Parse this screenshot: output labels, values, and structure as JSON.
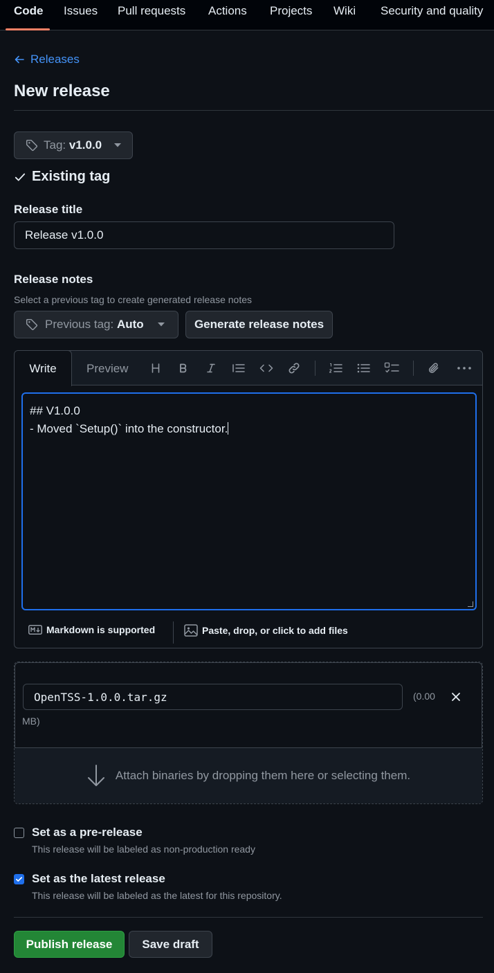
{
  "nav": {
    "tabs": [
      {
        "label": "Code",
        "active": true
      },
      {
        "label": "Issues"
      },
      {
        "label": "Pull requests"
      },
      {
        "label": "Actions"
      },
      {
        "label": "Projects"
      },
      {
        "label": "Wiki"
      },
      {
        "label": "Security and quality"
      }
    ]
  },
  "breadcrumb": {
    "back_label": "Releases"
  },
  "page": {
    "title": "New release"
  },
  "tag": {
    "prefix": "Tag:",
    "value": "v1.0.0",
    "status": "Existing tag"
  },
  "release_title": {
    "label": "Release title",
    "value": "Release v1.0.0"
  },
  "release_notes": {
    "label": "Release notes",
    "hint": "Select a previous tag to create generated release notes",
    "previous_tag_prefix": "Previous tag:",
    "previous_tag_value": "Auto",
    "generate_label": "Generate release notes"
  },
  "editor": {
    "write_tab": "Write",
    "preview_tab": "Preview",
    "lines": [
      "## V1.0.0",
      "- Moved `Setup()` into the constructor."
    ],
    "markdown_label": "Markdown is supported",
    "attach_label": "Paste, drop, or click to add files"
  },
  "attachments": {
    "file_name": "OpenTSS-1.0.0.tar.gz",
    "size_line1": "(0.00",
    "size_line2": "MB)",
    "drop_label": "Attach binaries by dropping them here or selecting them."
  },
  "options": {
    "prerelease": {
      "title": "Set as a pre-release",
      "desc": "This release will be labeled as non-production ready",
      "checked": false
    },
    "latest": {
      "title": "Set as the latest release",
      "desc": "This release will be labeled as the latest for this repository.",
      "checked": true
    }
  },
  "actions": {
    "publish_label": "Publish release",
    "draft_label": "Save draft"
  },
  "colors": {
    "accent": "#4493f8",
    "primary_button": "#238636",
    "focus_border": "#1f6feb",
    "nav_underline": "#f78166"
  }
}
